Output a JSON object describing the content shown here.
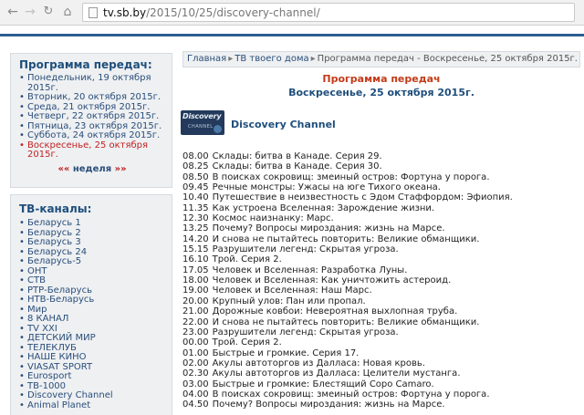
{
  "browser": {
    "url_host": "tv.sb.by",
    "url_path": "/2015/10/25/discovery-channel/",
    "icons": [
      "back-arrow-icon",
      "forward-arrow-icon",
      "reload-icon",
      "home-icon",
      "page-icon"
    ]
  },
  "sidebar": {
    "schedule_title": "Программа передач:",
    "days": [
      {
        "label": "Понедельник, 19 октября 2015г.",
        "current": false
      },
      {
        "label": "Вторник, 20 октября 2015г.",
        "current": false
      },
      {
        "label": "Среда, 21 октября 2015г.",
        "current": false
      },
      {
        "label": "Четверг, 22 октября 2015г.",
        "current": false
      },
      {
        "label": "Пятница, 23 октября 2015г.",
        "current": false
      },
      {
        "label": "Суббота, 24 октября 2015г.",
        "current": false
      },
      {
        "label": "Воскресенье, 25 октября 2015г.",
        "current": true
      }
    ],
    "week_left": "««",
    "week_label": "неделя",
    "week_right": "»»",
    "channels_title": "ТВ-каналы:",
    "channels": [
      "Беларусь 1",
      "Беларусь 2",
      "Беларусь 3",
      "Беларусь 24",
      "Беларусь-5",
      "ОНТ",
      "СТВ",
      "РТР-Беларусь",
      "НТВ-Беларусь",
      "Мир",
      "8 КАНАЛ",
      "TV XXI",
      "ДЕТСКИЙ МИР",
      "ТЕЛЕКЛУБ",
      "НАШЕ КИНО",
      "VIASAT SPORT",
      "Eurosport",
      "ТВ-1000",
      "Discovery Channel",
      "Animal Planet"
    ]
  },
  "breadcrumb": {
    "items": [
      "Главная",
      "ТВ твоего дома",
      "Программа передач - Воскресенье, 25 октября 2015г."
    ],
    "separator": "▸"
  },
  "program": {
    "title": "Программа передач",
    "date": "Воскресенье, 25 октября 2015г.",
    "channel_name": "Discovery Channel",
    "logo_text": "Discovery",
    "logo_sub": "CHANNEL",
    "shows": [
      {
        "time": "08.00",
        "title": "Склады: битва в Канаде. Серия 29."
      },
      {
        "time": "08.25",
        "title": "Склады: битва в Канаде. Серия 30."
      },
      {
        "time": "08.50",
        "title": "В поисках сокровищ: змеиный остров: Фортуна у порога."
      },
      {
        "time": "09.45",
        "title": "Речные монстры: Ужасы на юге Тихого океана."
      },
      {
        "time": "10.40",
        "title": "Путешествие в неизвестность с Эдом Стаффордом: Эфиопия."
      },
      {
        "time": "11.35",
        "title": "Как устроена Вселенная: Зарождение жизни."
      },
      {
        "time": "12.30",
        "title": "Космос наизнанку: Марс."
      },
      {
        "time": "13.25",
        "title": "Почему? Вопросы мироздания: жизнь на Марсе."
      },
      {
        "time": "14.20",
        "title": "И снова не пытайтесь повторить: Великие обманщики."
      },
      {
        "time": "15.15",
        "title": "Разрушители легенд: Скрытая угроза."
      },
      {
        "time": "16.10",
        "title": "Трой. Серия 2."
      },
      {
        "time": "17.05",
        "title": "Человек и Вселенная: Разработка Луны."
      },
      {
        "time": "18.00",
        "title": "Человек и Вселенная: Как уничтожить астероид."
      },
      {
        "time": "19.00",
        "title": "Человек и Вселенная: Наш Марс."
      },
      {
        "time": "20.00",
        "title": "Крупный улов: Пан или пропал."
      },
      {
        "time": "21.00",
        "title": "Дорожные ковбои: Невероятная выхлопная труба."
      },
      {
        "time": "22.00",
        "title": "И снова не пытайтесь повторить: Великие обманщики."
      },
      {
        "time": "23.00",
        "title": "Разрушители легенд: Скрытая угроза."
      },
      {
        "time": "00.00",
        "title": "Трой. Серия 2."
      },
      {
        "time": "01.00",
        "title": "Быстрые и громкие. Серия 17."
      },
      {
        "time": "02.00",
        "title": "Акулы автоторгов из Далласа: Новая кровь."
      },
      {
        "time": "02.30",
        "title": "Акулы автоторгов из Далласа: Целители мустанга."
      },
      {
        "time": "03.00",
        "title": "Быстрые и громкие: Блестящий Соро Camaro."
      },
      {
        "time": "04.00",
        "title": "В поисках сокровищ: змеиный остров: Фортуна у порога."
      },
      {
        "time": "04.50",
        "title": "Почему? Вопросы мироздания: жизнь на Марсе."
      }
    ]
  },
  "colors": {
    "link": "#2a4e7a",
    "heading": "#1f4f7c",
    "current_day": "#c22020",
    "program_title": "#c43a17",
    "panel_bg": "#eef0f2",
    "top_rule": "#2b5e91"
  }
}
